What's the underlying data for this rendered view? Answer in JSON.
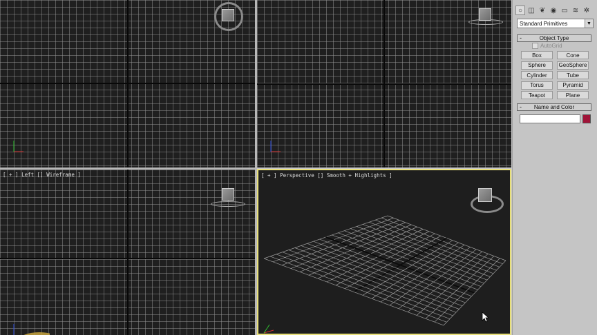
{
  "viewports": {
    "left_label": "[ + ] Left [] Wireframe ]",
    "perspective_label": "[ + ] Perspective [] Smooth + Highlights ]"
  },
  "panel": {
    "tabs": [
      {
        "icon": "create-icon",
        "glyph": "○",
        "active": true
      },
      {
        "icon": "modify-icon",
        "glyph": "◫",
        "active": false
      },
      {
        "icon": "hierarchy-icon",
        "glyph": "❦",
        "active": false
      },
      {
        "icon": "motion-icon",
        "glyph": "◉",
        "active": false
      },
      {
        "icon": "display-icon",
        "glyph": "▭",
        "active": false
      },
      {
        "icon": "utilities-icon",
        "glyph": "≋",
        "active": false
      },
      {
        "icon": "systems-icon",
        "glyph": "✲",
        "active": false
      }
    ],
    "category": "Standard Primitives",
    "object_type_title": "Object Type",
    "autogrid_label": "AutoGrid",
    "buttons": [
      "Box",
      "Cone",
      "Sphere",
      "GeoSphere",
      "Cylinder",
      "Tube",
      "Torus",
      "Pyramid",
      "Teapot",
      "Plane"
    ],
    "name_color_title": "Name and Color",
    "name_value": "",
    "swatch_color": "#a01438",
    "active_border_color": "#e8e07a"
  }
}
